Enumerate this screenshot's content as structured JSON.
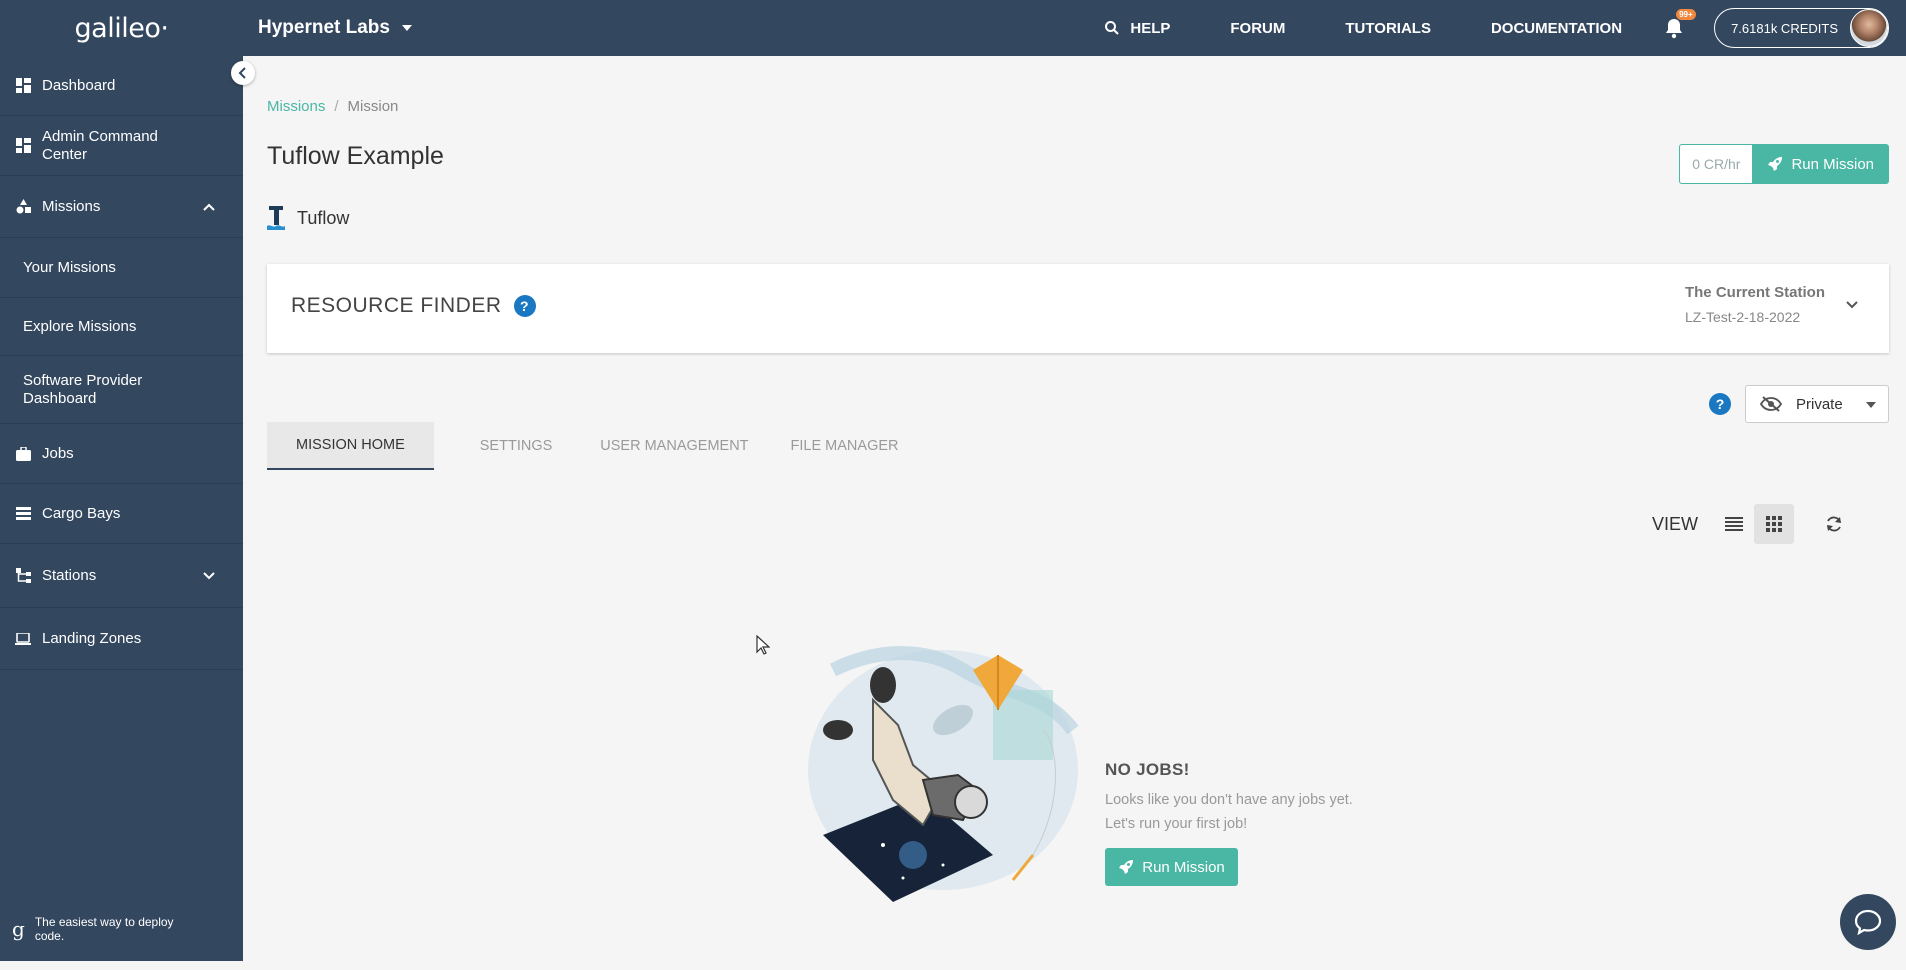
{
  "app": {
    "logo": "galileo·",
    "org_name": "Hypernet Labs"
  },
  "topnav": {
    "help": "HELP",
    "forum": "FORUM",
    "tutorials": "TUTORIALS",
    "documentation": "DOCUMENTATION",
    "notification_badge": "99+",
    "credits": "7.6181k CREDITS"
  },
  "sidebar": {
    "items": [
      {
        "label": "Dashboard",
        "icon": "dashboard-icon"
      },
      {
        "label": "Admin Command Center",
        "icon": "dashboard-icon"
      },
      {
        "label": "Missions",
        "icon": "shapes-icon",
        "expanded": true
      },
      {
        "label": "Your Missions"
      },
      {
        "label": "Explore Missions"
      },
      {
        "label": "Software Provider Dashboard"
      },
      {
        "label": "Jobs",
        "icon": "briefcase-icon"
      },
      {
        "label": "Cargo Bays",
        "icon": "list-icon"
      },
      {
        "label": "Stations",
        "icon": "sitemap-icon",
        "expanded": false
      },
      {
        "label": "Landing Zones",
        "icon": "laptop-icon"
      }
    ],
    "footer_logo": "g",
    "footer_text": "The easiest way to deploy code."
  },
  "breadcrumb": {
    "parent": "Missions",
    "separator": "/",
    "current": "Mission"
  },
  "mission": {
    "title": "Tuflow Example",
    "rate": "0 CR/hr",
    "run_label": "Run Mission",
    "software": "Tuflow"
  },
  "resource_finder": {
    "title": "RESOURCE FINDER",
    "help": "?",
    "station_label": "The Current Station",
    "station_value": "LZ-Test-2-18-2022"
  },
  "privacy": {
    "help": "?",
    "value": "Private"
  },
  "tabs": [
    {
      "label": "MISSION HOME",
      "active": true
    },
    {
      "label": "SETTINGS"
    },
    {
      "label": "USER MANAGEMENT"
    },
    {
      "label": "FILE MANAGER"
    }
  ],
  "view": {
    "label": "VIEW",
    "mode": "grid"
  },
  "empty_state": {
    "title": "NO JOBS!",
    "line1": "Looks like you don't have any jobs yet.",
    "line2": "Let's run your first job!",
    "button": "Run Mission"
  },
  "colors": {
    "sidebar": "#33475f",
    "accent": "#4ab6a4",
    "help_blue": "#1a78c2",
    "badge": "#f0883e"
  }
}
